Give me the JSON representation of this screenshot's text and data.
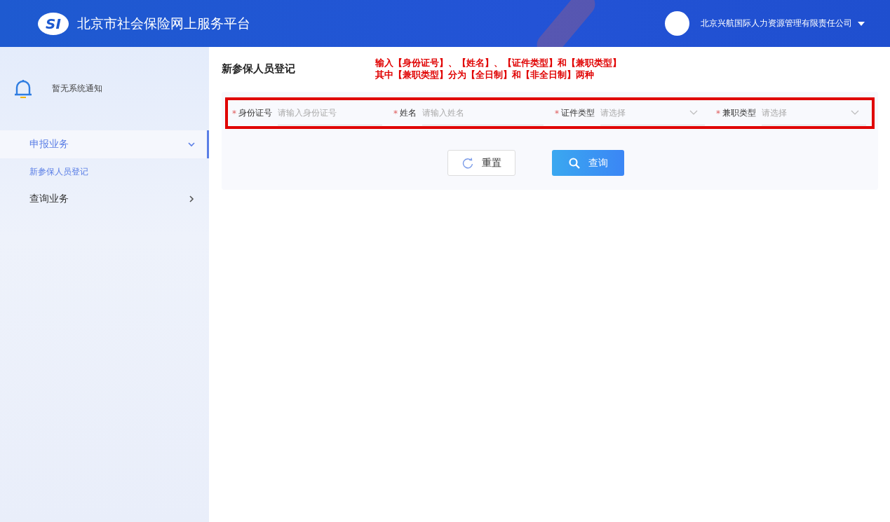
{
  "header": {
    "logo_text": "SI",
    "title": "北京市社会保险网上服务平台",
    "account": "北京兴航国际人力资源管理有限责任公司"
  },
  "sidebar": {
    "notice": "暂无系统通知",
    "menu": [
      {
        "label": "申报业务",
        "expanded": true,
        "selected": true,
        "children": [
          {
            "label": "新参保人员登记",
            "selected": true
          }
        ]
      },
      {
        "label": "查询业务",
        "expanded": false,
        "selected": false
      }
    ]
  },
  "page": {
    "title": "新参保人员登记",
    "annotation": [
      "输入【身份证号】、【姓名】、【证件类型】和【兼职类型】",
      "其中【兼职类型】分为【全日制】和【非全日制】两种"
    ],
    "fields": [
      {
        "kind": "input",
        "label": "身份证号",
        "placeholder": "请输入身份证号",
        "required_mark": "*"
      },
      {
        "kind": "input",
        "label": "姓名",
        "placeholder": "请输入姓名",
        "required_mark": "*"
      },
      {
        "kind": "select",
        "label": "证件类型",
        "placeholder": "请选择",
        "required_mark": "*"
      },
      {
        "kind": "select",
        "label": "兼职类型",
        "placeholder": "请选择",
        "required_mark": "*"
      }
    ],
    "buttons": [
      {
        "kind": "reset",
        "label": "重置"
      },
      {
        "kind": "search",
        "label": "查询"
      }
    ]
  }
}
